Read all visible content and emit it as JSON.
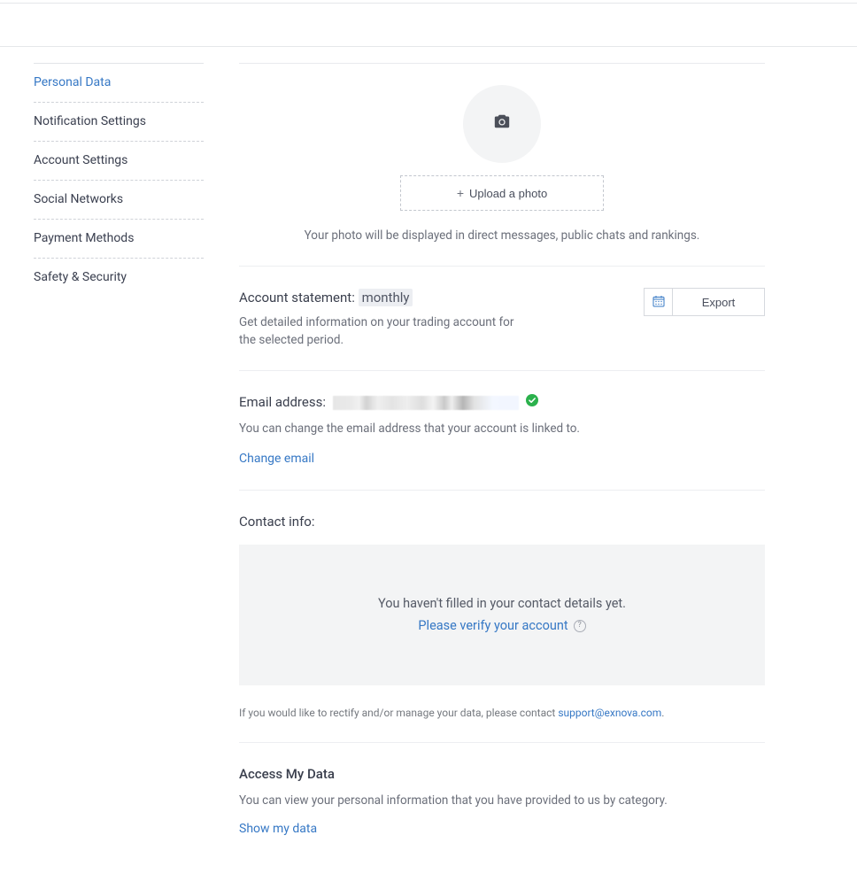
{
  "sidebar": {
    "items": [
      {
        "label": "Personal Data"
      },
      {
        "label": "Notification Settings"
      },
      {
        "label": "Account Settings"
      },
      {
        "label": "Social Networks"
      },
      {
        "label": "Payment Methods"
      },
      {
        "label": "Safety & Security"
      }
    ]
  },
  "photo": {
    "upload_label": "Upload a photo",
    "note": "Your photo will be displayed in direct messages, public chats and rankings."
  },
  "statement": {
    "heading_label": "Account statement:",
    "period": "monthly",
    "subtext": "Get detailed information on your trading account for the selected period.",
    "export_label": "Export"
  },
  "email": {
    "heading_label": "Email address:",
    "subtext": "You can change the email address that your account is linked to.",
    "change_link": "Change email"
  },
  "contact": {
    "heading": "Contact info:",
    "not_filled": "You haven't filled in your contact details yet.",
    "verify_link": "Please verify your account",
    "rectify_text": "If you would like to rectify and/or manage your data, please contact ",
    "support_email": "support@exnova.com",
    "period_after": "."
  },
  "access": {
    "heading": "Access My Data",
    "subtext": "You can view your personal information that you have provided to us by category.",
    "show_link": "Show my data"
  }
}
